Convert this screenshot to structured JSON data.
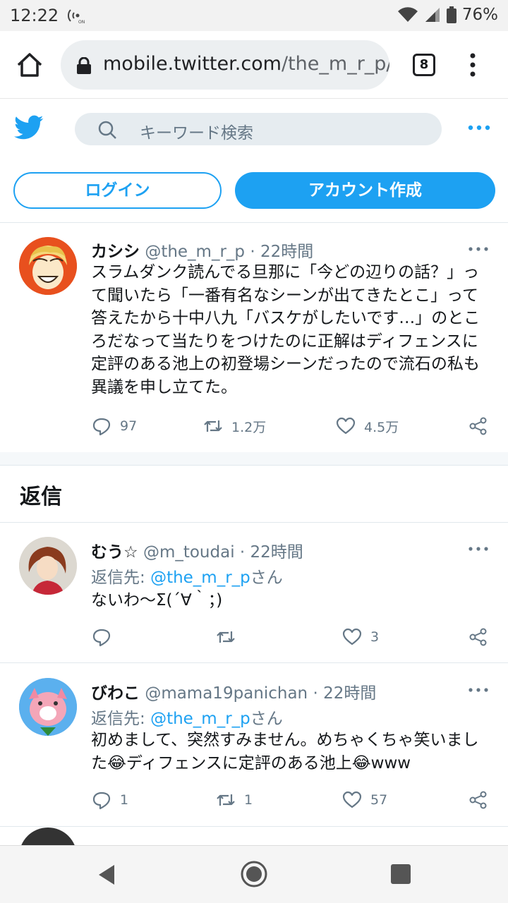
{
  "statusbar": {
    "time": "12:22",
    "battery": "76%"
  },
  "browser": {
    "url_host": "mobile.twitter.com",
    "url_path": "/the_m_r_p/s",
    "tab_count": "8"
  },
  "header": {
    "search_placeholder": "キーワード検索",
    "login_label": "ログイン",
    "signup_label": "アカウント作成"
  },
  "main_tweet": {
    "name": "カシシ",
    "handle_time": "@the_m_r_p · 22時間",
    "text": "スラムダンク読んでる旦那に「今どの辺りの話？」って聞いたら「一番有名なシーンが出てきたとこ」って答えたから十中八九「バスケがしたいです…」のところだなって当たりをつけたのに正解はディフェンスに定評のある池上の初登場シーンだったので流石の私も異議を申し立てた。",
    "replies": "97",
    "retweets": "1.2万",
    "likes": "4.5万"
  },
  "replies_title": "返信",
  "replies": [
    {
      "name": "むう☆",
      "handle_time": "@m_toudai · 22時間",
      "replyto_prefix": "返信先:",
      "replyto_handle": "@the_m_r_p",
      "replyto_suffix": "さん",
      "text": "ないわ〜Σ(´∀｀；)",
      "replies": "",
      "retweets": "",
      "likes": "3"
    },
    {
      "name": "びわこ",
      "handle_time": "@mama19panichan · 22時間",
      "replyto_prefix": "返信先:",
      "replyto_handle": "@the_m_r_p",
      "replyto_suffix": "さん",
      "text": "初めまして、突然すみません。めちゃくちゃ笑いました😂ディフェンスに定評のある池上😂www",
      "replies": "1",
      "retweets": "1",
      "likes": "57"
    }
  ],
  "colors": {
    "twitter_blue": "#1da1f2",
    "text_gray": "#657786",
    "border": "#e1e8ed"
  }
}
